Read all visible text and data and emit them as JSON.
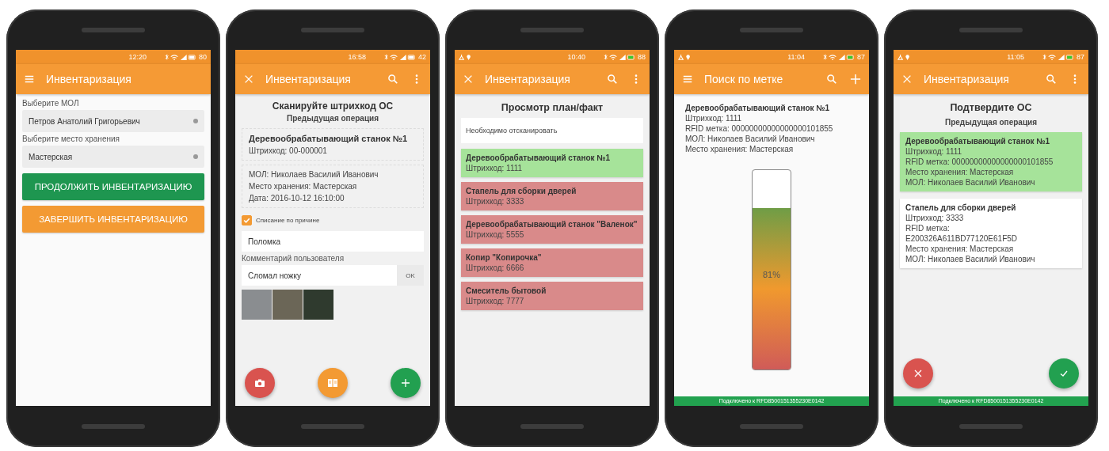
{
  "screens": [
    {
      "kind": "form",
      "status_bar": {
        "time": "12:20",
        "battery": "80"
      },
      "app_bar": {
        "title": "Инвентаризация"
      },
      "fields": [
        {
          "label": "Выберите МОЛ",
          "value": "Петров Анатолий Григорьевич"
        },
        {
          "label": "Выберите место хранения",
          "value": "Мастерская"
        }
      ],
      "buttons": [
        {
          "label": "ПРОДОЛЖИТЬ ИНВЕНТАРИЗАЦИЮ",
          "color": "#1e9650"
        },
        {
          "label": "ЗАВЕРШИТЬ ИНВЕНТАРИЗАЦИЮ",
          "color": "#f39a33"
        }
      ]
    },
    {
      "kind": "scan",
      "status_bar": {
        "time": "16:58",
        "battery": "42"
      },
      "app_bar": {
        "title": "Инвентаризация"
      },
      "heading": "Сканируйте штрихкод ОС",
      "subheading": "Предыдущая операция",
      "asset": {
        "name": "Деревообрабатывающий станок №1",
        "lines": [
          "Штрихкод: 00-000001"
        ]
      },
      "details": [
        "МОЛ: Николаев Василий Иванович",
        "Место хранения: Мастерская",
        "Дата: 2016-10-12 16:10:00"
      ],
      "checkbox": {
        "label": "Списание по причине",
        "checked": true
      },
      "reason": {
        "value": "Поломка"
      },
      "comment_label": "Комментарий пользователя",
      "comment": {
        "value": "Сломал ножку"
      },
      "ok_button": "OK",
      "fabs": [
        {
          "color": "#d9534f"
        },
        {
          "color": "#f39a33"
        },
        {
          "color": "#22a050"
        }
      ]
    },
    {
      "kind": "plan",
      "status_bar": {
        "time": "10:40",
        "battery": "88"
      },
      "app_bar": {
        "title": "Инвентаризация"
      },
      "heading": "Просмотр план/факт",
      "note": "Необходимо отсканировать",
      "items": [
        {
          "name": "Деревообрабатывающий станок №1",
          "barcode": "Штрихкод: 1111",
          "color": "#a6e39a"
        },
        {
          "name": "Стапель для сборки дверей",
          "barcode": "Штрихкод: 3333",
          "color": "#d98a8a"
        },
        {
          "name": "Деревообрабатывающий станок \"Валенок\"",
          "barcode": "Штрихкод: 5555",
          "color": "#d98a8a"
        },
        {
          "name": "Копир \"Копирочка\"",
          "barcode": "Штрихкод: 6666",
          "color": "#d98a8a"
        },
        {
          "name": "Смеситель бытовой",
          "barcode": "Штрихкод: 7777",
          "color": "#d98a8a"
        }
      ]
    },
    {
      "kind": "search",
      "status_bar": {
        "time": "11:04",
        "battery": "87"
      },
      "app_bar": {
        "title": "Поиск по метке"
      },
      "name": "Деревообрабатывающий станок №1",
      "lines": [
        "Штрихкод: 1111",
        "RFID метка: 00000000000000000101855",
        "МОЛ: Николаев Василий Иванович",
        "Место хранения: Мастерская"
      ],
      "level": 0.81,
      "reading": "81%",
      "footer": "Подключено к RFD8500151355230E0142"
    },
    {
      "kind": "confirm",
      "status_bar": {
        "time": "11:05",
        "battery": "87"
      },
      "app_bar": {
        "title": "Инвентаризация"
      },
      "heading": "Подтвердите ОС",
      "subheading": "Предыдущая операция",
      "cards": [
        {
          "name": "Деревообрабатывающий станок №1",
          "color": "#a6e39a",
          "lines": [
            "Штрихкод: 1111",
            "RFID метка: 00000000000000000101855",
            "Место хранения: Мастерская",
            "МОЛ: Николаев Василий Иванович"
          ]
        },
        {
          "name": "Стапель для сборки дверей",
          "color": "#ffffff",
          "lines": [
            "Штрихкод: 3333",
            "RFID метка:",
            "E200326A611BD77120E61F5D",
            "Место хранения: Мастерская",
            "МОЛ: Николаев Василий Иванович"
          ]
        }
      ],
      "fabs": [
        {
          "color": "#d9534f"
        },
        {
          "color": "#22a050"
        }
      ],
      "footer": "Подключено к RFD8500151355230E0142"
    }
  ]
}
